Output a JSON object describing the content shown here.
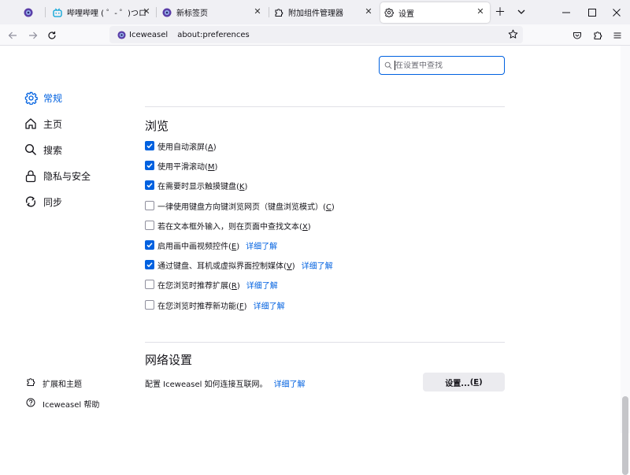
{
  "tabs": [
    {
      "title": "",
      "icon": "iceweasel-icon",
      "active": false
    },
    {
      "title": "哔哩哔哩 ( ゜- ゜)つロ 干杯~-bilibili",
      "icon": "bilibili-icon",
      "active": false
    },
    {
      "title": "新标签页",
      "icon": "iceweasel-icon",
      "active": false
    },
    {
      "title": "附加组件管理器",
      "icon": "puzzle-icon",
      "active": false
    },
    {
      "title": "设置",
      "icon": "gear-icon",
      "active": true
    }
  ],
  "urlbar": {
    "identity": "Iceweasel",
    "url": "about:preferences"
  },
  "search": {
    "placeholder": "在设置中查找"
  },
  "sidebar": {
    "items": [
      {
        "label": "常规",
        "icon": "gear-icon",
        "selected": true
      },
      {
        "label": "主页",
        "icon": "home-icon",
        "selected": false
      },
      {
        "label": "搜索",
        "icon": "search-icon",
        "selected": false
      },
      {
        "label": "隐私与安全",
        "icon": "lock-icon",
        "selected": false
      },
      {
        "label": "同步",
        "icon": "sync-icon",
        "selected": false
      }
    ],
    "footer": [
      {
        "label": "扩展和主题",
        "icon": "puzzle-icon"
      },
      {
        "label": "Iceweasel 帮助",
        "icon": "help-icon"
      }
    ]
  },
  "browsing": {
    "title": "浏览",
    "options": [
      {
        "label": "使用自动滚屏",
        "key": "A",
        "checked": true,
        "link": ""
      },
      {
        "label": "使用平滑滚动",
        "key": "M",
        "checked": true,
        "link": ""
      },
      {
        "label": "在需要时显示触摸键盘",
        "key": "K",
        "checked": true,
        "link": ""
      },
      {
        "label": "一律使用键盘方向键浏览网页（键盘浏览模式）",
        "key": "C",
        "checked": false,
        "link": ""
      },
      {
        "label": "若在文本框外输入，则在页面中查找文本",
        "key": "X",
        "checked": false,
        "link": ""
      },
      {
        "label": "启用画中画视频控件",
        "key": "E",
        "checked": true,
        "link": "详细了解"
      },
      {
        "label": "通过键盘、耳机或虚拟界面控制媒体",
        "key": "V",
        "checked": true,
        "link": "详细了解"
      },
      {
        "label": "在您浏览时推荐扩展",
        "key": "R",
        "checked": false,
        "link": "详细了解"
      },
      {
        "label": "在您浏览时推荐新功能",
        "key": "F",
        "checked": false,
        "link": "详细了解"
      }
    ]
  },
  "network": {
    "title": "网络设置",
    "description": "配置 Iceweasel 如何连接互联网。",
    "link": "详细了解",
    "button_label": "设置...",
    "button_key": "E"
  },
  "colors": {
    "accent": "#0061e0",
    "tab_strip": "#f0f0f4"
  }
}
